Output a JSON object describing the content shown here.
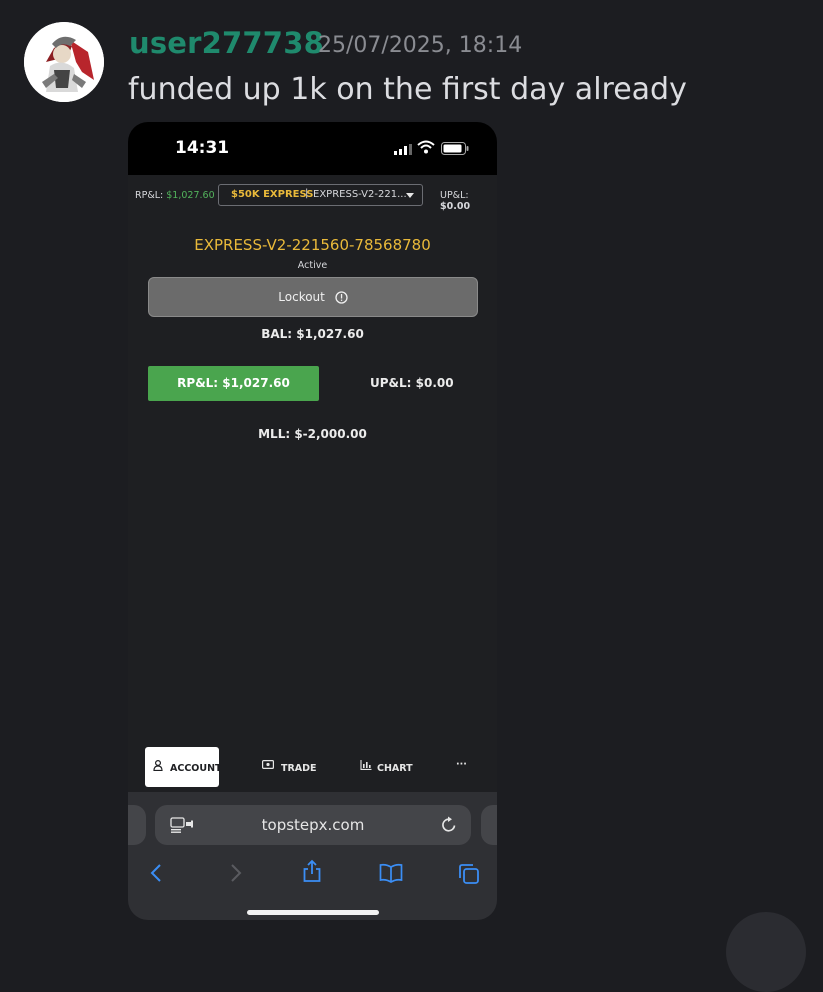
{
  "message": {
    "username": "user277738",
    "timestamp": "25/07/2025, 18:14",
    "text": "funded up 1k on the first day already"
  },
  "phone": {
    "status_bar": {
      "time": "14:31"
    },
    "top_bar": {
      "rpl_label": "RP&L:",
      "rpl_value": "$1,027.60",
      "account_tag": "$50K EXPRESS",
      "separator": "|",
      "account_short": "EXPRESS-V2-221...",
      "upl_label": "UP&L:",
      "upl_value": "$0.00"
    },
    "account": {
      "id": "EXPRESS-V2-221560-78568780",
      "status": "Active",
      "lockout_label": "Lockout",
      "balance": "BAL: $1,027.60",
      "rpl_button": "RP&L: $1,027.60",
      "upl": "UP&L: $0.00",
      "mll": "MLL: $-2,000.00"
    },
    "tabs": [
      {
        "label": "ACCOUNT",
        "icon": "person-icon",
        "active": true
      },
      {
        "label": "TRADE",
        "icon": "trade-icon",
        "active": false
      },
      {
        "label": "CHART",
        "icon": "chart-icon",
        "active": false
      },
      {
        "label": "···",
        "icon": "more-icon",
        "active": false
      }
    ],
    "browser": {
      "url": "topstepx.com",
      "nav_icons": [
        "back-icon",
        "forward-icon",
        "share-icon",
        "bookmarks-icon",
        "tabs-icon"
      ]
    }
  },
  "colors": {
    "username": "#1f8a6d",
    "accent_gold": "#e9b93a",
    "profit_green": "#4aa54e"
  }
}
